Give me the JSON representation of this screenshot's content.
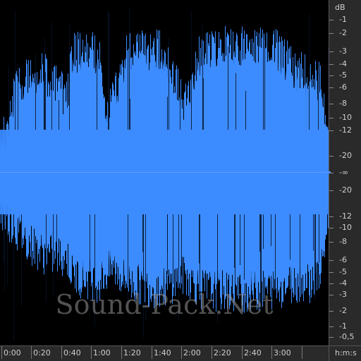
{
  "db_scale": {
    "unit": "dB",
    "top_labels": [
      "-1",
      "-2",
      "-3",
      "-4",
      "-5",
      "-6",
      "-8",
      "-10",
      "-12",
      "-20"
    ],
    "center_label": "-∞",
    "bottom_labels": [
      "-20",
      "-12",
      "-10",
      "-8",
      "-6",
      "-5",
      "-4",
      "-3",
      "-2",
      "-1",
      "-0,5"
    ]
  },
  "time_ruler": {
    "unit": "h:m:s",
    "labels": [
      "0:00",
      "0:20",
      "0:40",
      "1:00",
      "1:20",
      "1:40",
      "2:00",
      "2:20",
      "2:40",
      "3:00"
    ]
  },
  "watermark": "Sound-Pack.Net",
  "colors": {
    "waveform": "#3c8cff",
    "waveform_edge": "#2f6fd6",
    "background": "#000000",
    "ruler": "#2a2a2a",
    "ruler_text": "#cfcfcf"
  }
}
